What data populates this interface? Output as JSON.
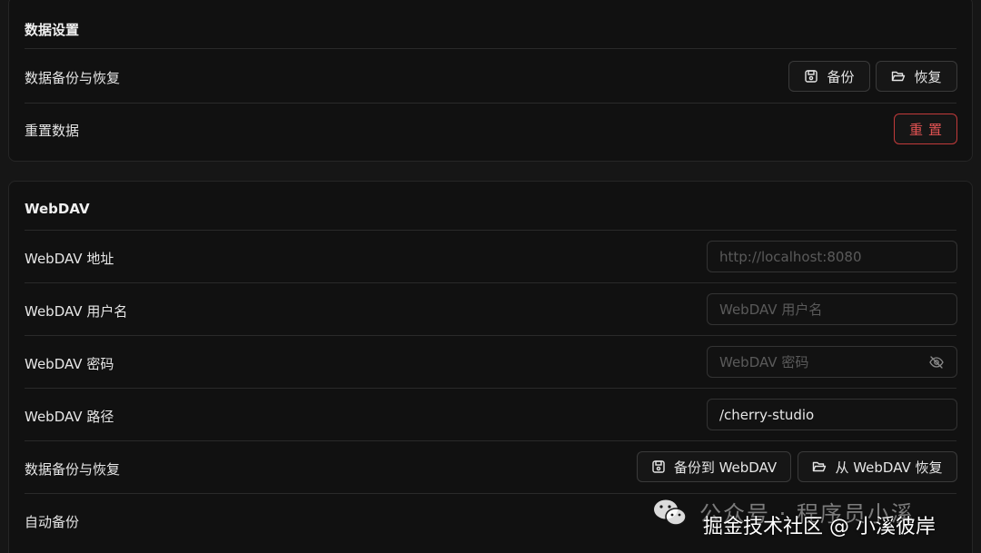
{
  "data_settings": {
    "title": "数据设置",
    "backup_row_label": "数据备份与恢复",
    "backup_button": "备份",
    "restore_button": "恢复",
    "reset_row_label": "重置数据",
    "reset_button": "重置"
  },
  "webdav": {
    "title": "WebDAV",
    "address_label": "WebDAV 地址",
    "address_placeholder": "http://localhost:8080",
    "username_label": "WebDAV 用户名",
    "username_placeholder": "WebDAV 用户名",
    "password_label": "WebDAV 密码",
    "password_placeholder": "WebDAV 密码",
    "path_label": "WebDAV 路径",
    "path_value": "/cherry-studio",
    "backup_row_label": "数据备份与恢复",
    "backup_button": "备份到 WebDAV",
    "restore_button": "从 WebDAV 恢复",
    "auto_backup_label": "自动备份"
  },
  "watermark": {
    "line1": "公众号 · 程序员小溪",
    "line2": "掘金技术社区 @ 小溪彼岸"
  },
  "colors": {
    "background": "#161616",
    "card": "#111111",
    "danger": "#e05252"
  }
}
